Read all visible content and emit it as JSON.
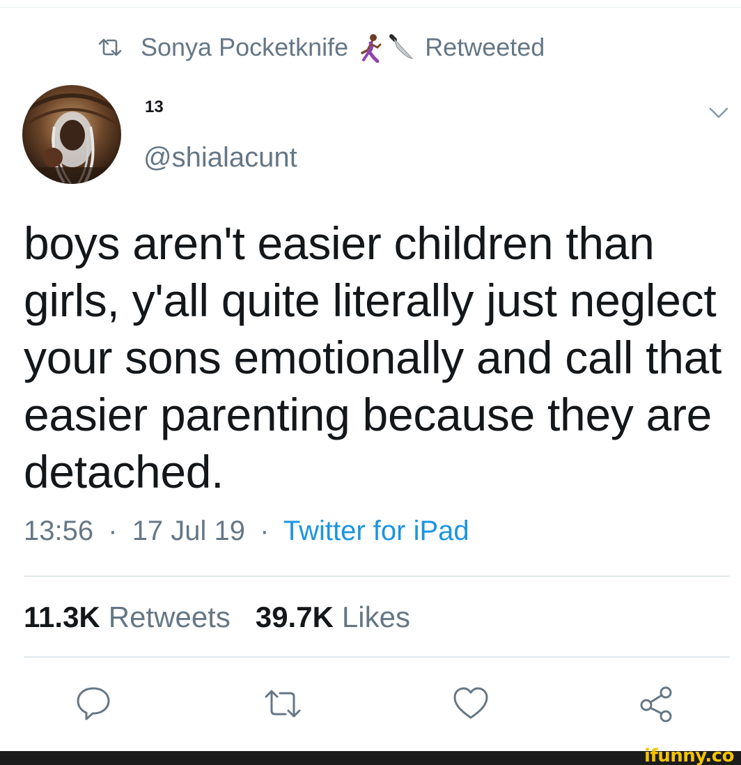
{
  "header": {
    "retweet_icon": "retweet-icon",
    "retweeter_name": "Sonya Pocketknife",
    "emojis": [
      "woman-running-emoji",
      "knife-emoji"
    ],
    "retweeted_label": "Retweeted"
  },
  "author": {
    "display_name": "13",
    "handle": "@shialacunt",
    "avatar": "profile-photo",
    "menu_icon": "chevron-down-icon"
  },
  "tweet": {
    "text": "boys aren't easier children than girls, y'all quite literally just neglect your sons emotionally and call that easier parenting because they are detached.",
    "time": "13:56",
    "date": "17 Jul 19",
    "separator": "·",
    "source": "Twitter for iPad"
  },
  "stats": {
    "retweets_count": "11.3K",
    "retweets_label": "Retweets",
    "likes_count": "39.7K",
    "likes_label": "Likes"
  },
  "actions": [
    {
      "name": "reply",
      "icon": "reply-icon"
    },
    {
      "name": "retweet",
      "icon": "retweet-icon"
    },
    {
      "name": "like",
      "icon": "heart-icon"
    },
    {
      "name": "share",
      "icon": "share-icon"
    }
  ],
  "watermark": "ifunny.co",
  "colors": {
    "text_primary": "#14171a",
    "text_secondary": "#657786",
    "link_blue": "#1b95e0",
    "divider": "#e1e8ed"
  }
}
